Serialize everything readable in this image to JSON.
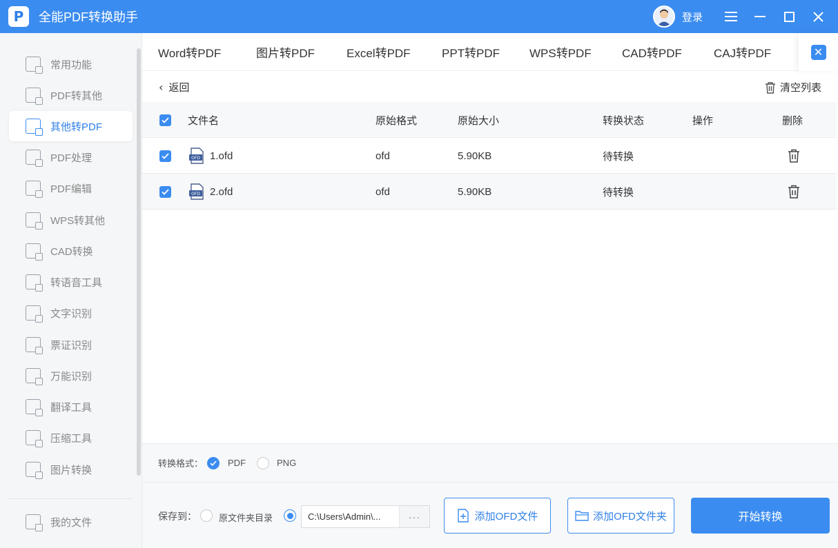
{
  "app": {
    "title": "全能PDF转换助手",
    "login_label": "登录"
  },
  "sidebar": {
    "items": [
      {
        "label": "常用功能"
      },
      {
        "label": "PDF转其他"
      },
      {
        "label": "其他转PDF"
      },
      {
        "label": "PDF处理"
      },
      {
        "label": "PDF编辑"
      },
      {
        "label": "WPS转其他"
      },
      {
        "label": "CAD转换"
      },
      {
        "label": "转语音工具"
      },
      {
        "label": "文字识别"
      },
      {
        "label": "票证识别"
      },
      {
        "label": "万能识别"
      },
      {
        "label": "翻译工具"
      },
      {
        "label": "压缩工具"
      },
      {
        "label": "图片转换"
      }
    ],
    "active_index": 2,
    "footer_label": "我的文件"
  },
  "tabs": [
    "Word转PDF",
    "图片转PDF",
    "Excel转PDF",
    "PPT转PDF",
    "WPS转PDF",
    "CAD转PDF",
    "CAJ转PDF"
  ],
  "toolbar": {
    "back_label": "返回",
    "clear_label": "清空列表"
  },
  "table": {
    "headers": {
      "name": "文件名",
      "format": "原始格式",
      "size": "原始大小",
      "status": "转换状态",
      "action": "操作",
      "delete": "删除"
    },
    "rows": [
      {
        "name": "1.ofd",
        "format": "ofd",
        "size": "5.90KB",
        "status": "待转换",
        "icon_text": "OFD"
      },
      {
        "name": "2.ofd",
        "format": "ofd",
        "size": "5.90KB",
        "status": "待转换",
        "icon_text": "OFD"
      }
    ]
  },
  "format": {
    "label": "转换格式：",
    "options": [
      "PDF",
      "PNG"
    ],
    "selected": "PDF"
  },
  "save": {
    "label": "保存到：",
    "option_source": "原文件夹目录",
    "path": "C:\\Users\\Admin\\...",
    "more": "···"
  },
  "buttons": {
    "add_file": "添加OFD文件",
    "add_folder": "添加OFD文件夹",
    "start": "开始转换"
  },
  "colors": {
    "accent": "#3b8cf0",
    "sidebar_bg": "#f5f6f8"
  }
}
